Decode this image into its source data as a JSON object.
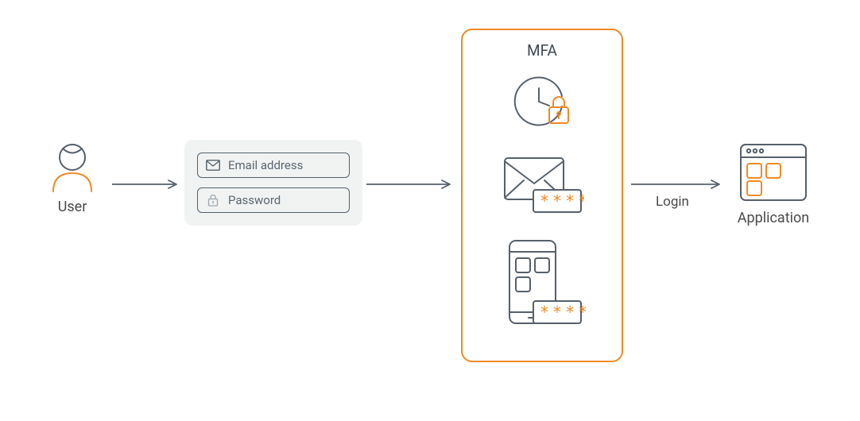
{
  "user": {
    "label": "User"
  },
  "credentials": {
    "email_label": "Email address",
    "password_label": "Password"
  },
  "mfa": {
    "title": "MFA"
  },
  "arrow": {
    "login_label": "Login"
  },
  "application": {
    "label": "Application"
  }
}
